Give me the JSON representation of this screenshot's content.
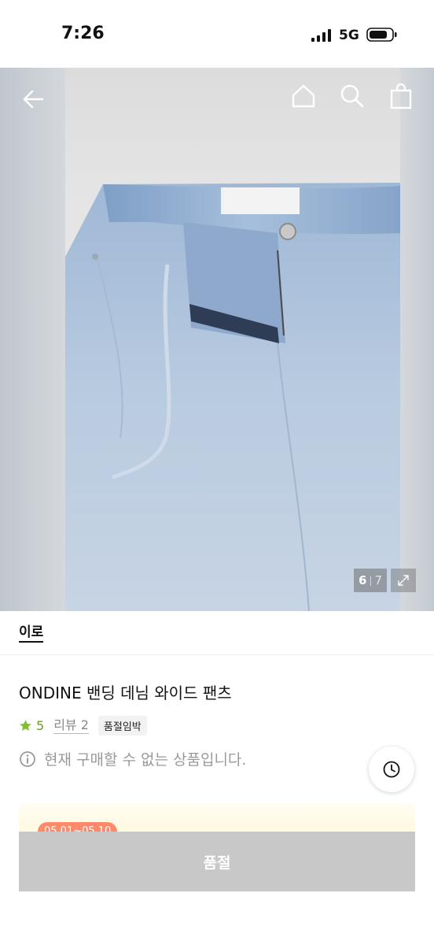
{
  "status_bar": {
    "time": "7:26",
    "network": "5G"
  },
  "gallery": {
    "current_index": "6",
    "separator": "|",
    "total": "7"
  },
  "brand": {
    "name": "이로"
  },
  "product": {
    "title": "ONDINE 밴딩 데님 와이드 팬츠",
    "rating": "5",
    "review_label": "리뷰 2",
    "stock_badge": "품절임박",
    "notice": "현재 구매할 수 없는 상품입니다."
  },
  "promo": {
    "date_label": "05.01~05.10"
  },
  "purchase": {
    "button_label": "품절"
  },
  "colors": {
    "rating_star": "#6b9d2a",
    "soldout_button": "#c8c8c8",
    "promo_tag": "#ff8a6b"
  },
  "icons": [
    "back-arrow-icon",
    "home-icon",
    "search-icon",
    "shopping-bag-icon",
    "expand-icon",
    "star-icon",
    "info-icon",
    "clock-icon",
    "signal-icon",
    "battery-icon"
  ]
}
